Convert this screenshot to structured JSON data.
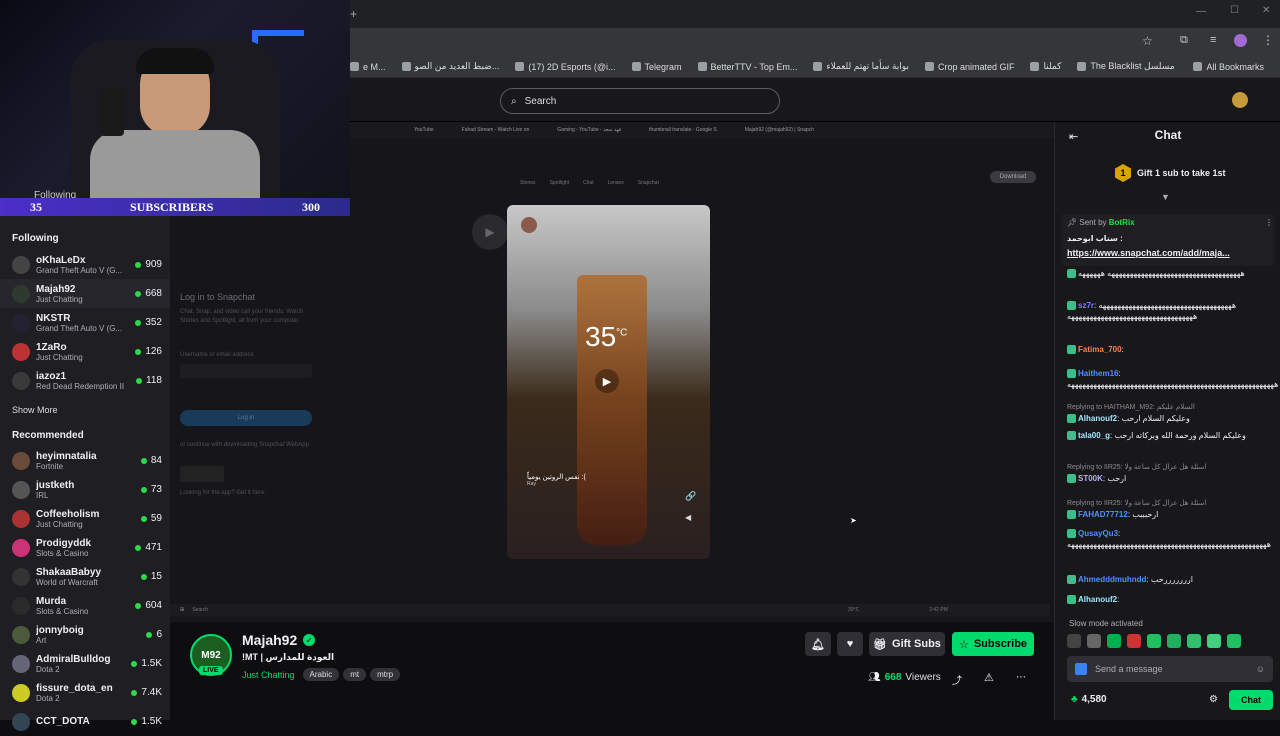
{
  "bookmarks": [
    {
      "label": "e M...",
      "icon": "page-icon"
    },
    {
      "label": "ضبط العديد من الصو...",
      "icon": "diamond-icon"
    },
    {
      "label": "(17) 2D Esports (@i...",
      "icon": "x-icon"
    },
    {
      "label": "Telegram",
      "icon": "telegram-icon"
    },
    {
      "label": "BetterTTV - Top Em...",
      "icon": "bttv-icon"
    },
    {
      "label": "بوابة سأما تهتم للعملاء",
      "icon": "page-icon"
    },
    {
      "label": "Crop animated GIF",
      "icon": "crop-icon"
    },
    {
      "label": "كملنا",
      "icon": "page-icon"
    },
    {
      "label": "The Blacklist مسلسل",
      "icon": "page-icon"
    },
    {
      "label": "All Bookmarks",
      "icon": "folder-icon"
    }
  ],
  "search": {
    "placeholder": "Search"
  },
  "overlay": {
    "following_label": "Following",
    "following_count": "35",
    "subscribers_label": "SUBSCRIBERS",
    "subscribers_count": "300"
  },
  "sidebar": {
    "following_title": "Following",
    "following": [
      {
        "name": "oKhaLeDx",
        "game": "Grand Theft Auto V (G...",
        "viewers": "909",
        "color": "#444"
      },
      {
        "name": "Majah92",
        "game": "Just Chatting",
        "viewers": "668",
        "color": "#2d3a2d"
      },
      {
        "name": "NKSTR",
        "game": "Grand Theft Auto V (G...",
        "viewers": "352",
        "color": "#223"
      },
      {
        "name": "1ZaRo",
        "game": "Just Chatting",
        "viewers": "126",
        "color": "#b33"
      },
      {
        "name": "iazoz1",
        "game": "Red Dead Redemption II",
        "viewers": "118",
        "color": "#3a3a3a"
      }
    ],
    "show_more": "Show More",
    "recommended_title": "Recommended",
    "recommended": [
      {
        "name": "heyimnatalia",
        "game": "Fortnite",
        "viewers": "84",
        "color": "#6a4a3a"
      },
      {
        "name": "justketh",
        "game": "IRL",
        "viewers": "73",
        "color": "#555"
      },
      {
        "name": "Coffeeholism",
        "game": "Just Chatting",
        "viewers": "59",
        "color": "#a33"
      },
      {
        "name": "Prodigyddk",
        "game": "Slots & Casino",
        "viewers": "471",
        "color": "#c37"
      },
      {
        "name": "ShakaaBabyy",
        "game": "World of Warcraft",
        "viewers": "15",
        "color": "#333"
      },
      {
        "name": "Murda",
        "game": "Slots & Casino",
        "viewers": "604",
        "color": "#2a2a2a"
      },
      {
        "name": "jonnyboig",
        "game": "Art",
        "viewers": "6",
        "color": "#4a5a3a"
      },
      {
        "name": "AdmiralBulldog",
        "game": "Dota 2",
        "viewers": "1.5K",
        "color": "#667"
      },
      {
        "name": "fissure_dota_en",
        "game": "Dota 2",
        "viewers": "7.4K",
        "color": "#cc2"
      },
      {
        "name": "CCT_DOTA",
        "game": "",
        "viewers": "1.5K",
        "color": "#345"
      }
    ]
  },
  "player": {
    "tabs": [
      "YouTube",
      "Fahad Stream - Watch Live on",
      "Gaming - YouTube - فهد سعد",
      "thumbnail translate - Google S",
      "Majah92 (@majah92) | Snapch"
    ],
    "snap_login_title": "Log in to Snapchat",
    "snap_login_desc": "Chat, Snap, and video call your friends. Watch Stories and Spotlight, all from your computer.",
    "snap_username_label": "Username or email address",
    "snap_login_button": "Log in",
    "snap_alt": "or continue with downloading Snapchat WebApp",
    "snap_app": "Looking for the app? Get it here.",
    "snap_nav": [
      "Stories",
      "Spotlight",
      "Chat",
      "Lenses",
      "Snapchat"
    ],
    "snap_download": "Download",
    "snap_temp": "35",
    "snap_caption": "نفس الروتين يومياً :(",
    "snap_caption_sub": "Ray",
    "taskbar_search": "Search",
    "taskbar_temp": "39°C",
    "taskbar_time": "2:42 PM"
  },
  "channel": {
    "name": "Majah92",
    "title": "!MT | العودة للمدارس",
    "category": "Just Chatting",
    "tags": [
      "Arabic",
      "mt",
      "mtrp"
    ],
    "live_label": "LIVE",
    "avatar_text": "M92",
    "gift_subs": "Gift Subs",
    "subscribe": "Subscribe",
    "viewers": "668",
    "viewers_label": "Viewers"
  },
  "chat": {
    "title": "Chat",
    "gift_banner": "Gift 1 sub to take 1st",
    "gift_rank": "1",
    "pinned_by_label": "Sent by",
    "pinned_by": "BotRix",
    "pinned_text": "سناب ابوحمد :",
    "pinned_link": "https://www.snapchat.com/add/maja...",
    "messages": [
      {
        "user": "",
        "color": "#efeff1",
        "text": "ههههههههههههههههههههههههههههههههههههه ههههههه"
      },
      {
        "user": "sz7r",
        "color": "#7b7bff",
        "text": ": ههههههههههههههههههههههههههههههههههههه ههههههههههههههههههههههههههههههههههه"
      },
      {
        "user": "Fatima_700",
        "color": "#ff7f50",
        "text": ":"
      },
      {
        "user": "Haithem16",
        "color": "#4f8fff",
        "text": ": ههههههههههههههههههههههههههههههههههههههههههههههههههههههههه"
      },
      {
        "reply": "Replying to HAITHAM_M92: السلام عليكم",
        "user": "Alhanouf2",
        "color": "#9ee7ff",
        "text": ": وعليكم السلام ارحب"
      },
      {
        "user": "tala00_g",
        "color": "#9ee7ff",
        "text": ": وعليكم السلام ورحمة الله وبركاته ارحب"
      },
      {
        "reply": "Replying to IIR25: اسئلة هل عزال كل ساعة ولا",
        "user": "ST00K",
        "color": "#b0b0ff",
        "text": ": ارحب"
      },
      {
        "reply": "Replying to IIR25: اسئلة هل عزال كل ساعة ولا",
        "user": "FAHAD77712",
        "color": "#4f8fff",
        "text": ": ارحبببب"
      },
      {
        "user": "QusayQu3",
        "color": "#4f8fff",
        "text": ": ههههههههههههههههههههههههههههههههههههههههههههههههههههههه"
      },
      {
        "user": "Ahmedddmuhndd",
        "color": "#4f8fff",
        "text": ": ارررررررحب"
      },
      {
        "user": "Alhanouf2",
        "color": "#9ee7ff",
        "text": ":"
      }
    ],
    "slow_mode": "Slow mode activated",
    "send_placeholder": "Send a message",
    "points": "4,580",
    "chat_button": "Chat"
  },
  "colors": {
    "accent": "#00db6e",
    "twitch_purple": "#9147ff",
    "live_green": "#00db6e"
  }
}
